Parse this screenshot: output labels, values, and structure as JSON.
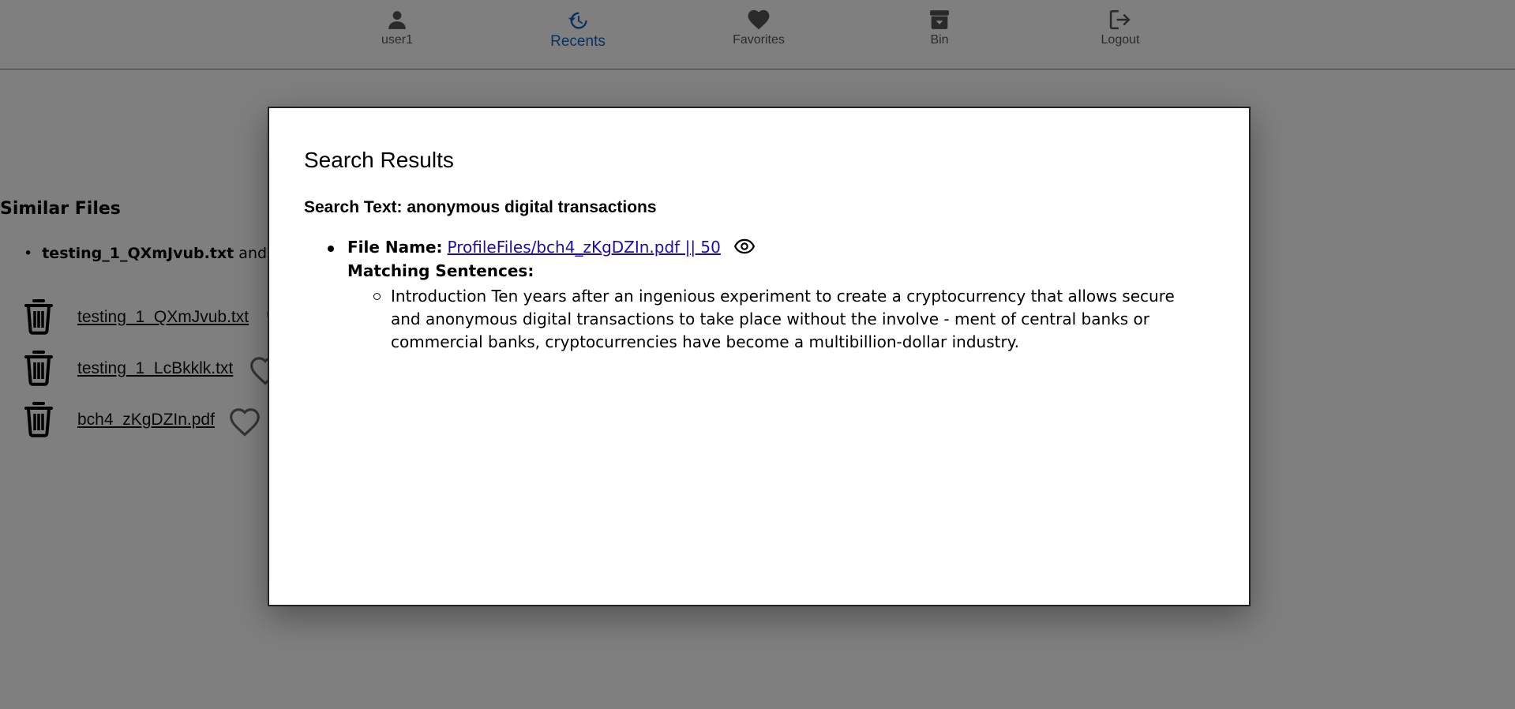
{
  "nav": {
    "items": [
      {
        "label": "user1",
        "icon": "user-icon"
      },
      {
        "label": "Recents",
        "icon": "history-icon",
        "active": true
      },
      {
        "label": "Favorites",
        "icon": "heart-icon"
      },
      {
        "label": "Bin",
        "icon": "archive-icon"
      },
      {
        "label": "Logout",
        "icon": "logout-icon"
      }
    ],
    "active_color": "#1565c0"
  },
  "similar": {
    "title": "Similar Files",
    "items": [
      {
        "name": "testing_1_QXmJvub.txt",
        "suffix": " and"
      }
    ]
  },
  "files": [
    {
      "name": "testing_1_QXmJvub.txt"
    },
    {
      "name": "testing_1_LcBkklk.txt"
    },
    {
      "name": "bch4_zKgDZIn.pdf"
    }
  ],
  "modal": {
    "title": "Search Results",
    "search_text_label": "Search Text: anonymous digital transactions",
    "results": [
      {
        "file_label": "File Name:",
        "file_link": "ProfileFiles/bch4_zKgDZIn.pdf || 50",
        "matching_label": "Matching Sentences:",
        "sentences": [
          "Introduction Ten years after an ingenious experiment to create a cryptocurrency that allows secure and anonymous digital transactions to take place without the involve - ment of central banks or commercial banks, cryptocurrencies have become a multibillion-dollar industry."
        ]
      }
    ]
  }
}
